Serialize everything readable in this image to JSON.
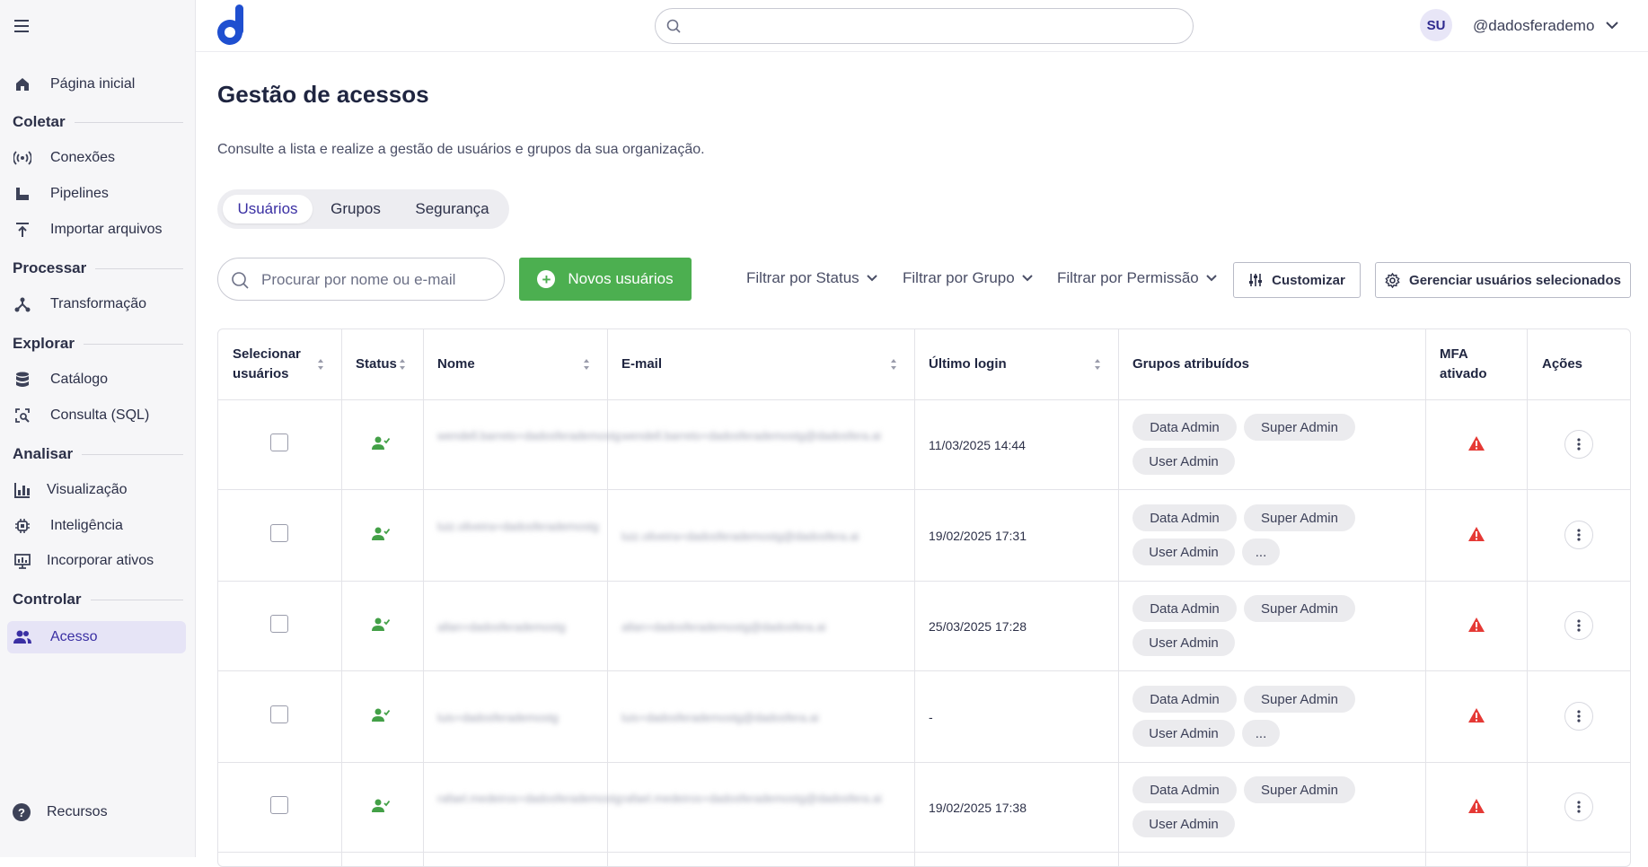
{
  "sidebar": {
    "items": [
      {
        "id": "home",
        "label": "Página inicial",
        "icon": "home-icon"
      },
      {
        "id": "conexoes",
        "label": "Conexões",
        "icon": "broadcast-icon"
      },
      {
        "id": "pipelines",
        "label": "Pipelines",
        "icon": "pipeline-icon"
      },
      {
        "id": "importar",
        "label": "Importar arquivos",
        "icon": "upload-icon"
      },
      {
        "id": "transformacao",
        "label": "Transformação",
        "icon": "transform-icon"
      },
      {
        "id": "catalogo",
        "label": "Catálogo",
        "icon": "database-icon"
      },
      {
        "id": "consulta",
        "label": "Consulta (SQL)",
        "icon": "query-icon"
      },
      {
        "id": "visualizacao",
        "label": "Visualização",
        "icon": "bar-chart-icon"
      },
      {
        "id": "inteligencia",
        "label": "Inteligência",
        "icon": "chip-icon"
      },
      {
        "id": "incorporar",
        "label": "Incorporar ativos",
        "icon": "embed-icon"
      },
      {
        "id": "acesso",
        "label": "Acesso",
        "icon": "users-icon",
        "active": true
      }
    ],
    "sections": [
      "Coletar",
      "Processar",
      "Explorar",
      "Analisar",
      "Controlar"
    ],
    "footer_label": "Recursos"
  },
  "header": {
    "avatar_initials": "SU",
    "username": "@dadosferademo"
  },
  "page": {
    "title": "Gestão de acessos",
    "subtitle": "Consulte a lista e realize a gestão de usuários e grupos da sua organização."
  },
  "tabs": [
    "Usuários",
    "Grupos",
    "Segurança"
  ],
  "toolbar": {
    "search_placeholder": "Procurar por nome ou e-mail",
    "new_users_label": "Novos usuários",
    "filter_status": "Filtrar por Status",
    "filter_group": "Filtrar por Grupo",
    "filter_permission": "Filtrar por Permissão",
    "customize_label": "Customizar",
    "manage_label": "Gerenciar usuários selecionados"
  },
  "table": {
    "headers": {
      "select_line1": "Selecionar",
      "select_line2": "usuários",
      "status": "Status",
      "name": "Nome",
      "email": "E-mail",
      "last_login": "Último login",
      "groups": "Grupos atribuídos",
      "mfa_line1": "MFA",
      "mfa_line2": "ativado",
      "actions": "Ações"
    },
    "rows": [
      {
        "name": "wendell.barreto+dadosferademostg",
        "email": "wendell.barreto+dadosferademostg@dadosfera.ai",
        "last_login": "11/03/2025 14:44",
        "groups": [
          "Data Admin",
          "Super Admin",
          "User Admin"
        ]
      },
      {
        "name": "luiz.oliveira+dadosferademostg",
        "email": "luiz.oliveira+dadosferademostg@dadosfera.ai",
        "last_login": "19/02/2025 17:31",
        "groups": [
          "Data Admin",
          "Super Admin",
          "User Admin",
          "..."
        ]
      },
      {
        "name": "allan+dadosferademostg",
        "email": "allan+dadosferademostg@dadosfera.ai",
        "last_login": "25/03/2025 17:28",
        "groups": [
          "Data Admin",
          "Super Admin",
          "User Admin"
        ]
      },
      {
        "name": "luis+dadosferademostg",
        "email": "luis+dadosferademostg@dadosfera.ai",
        "last_login": "-",
        "groups": [
          "Data Admin",
          "Super Admin",
          "User Admin",
          "..."
        ]
      },
      {
        "name": "rafael.medeiros+dadosferademostg",
        "email": "rafael.medeiros+dadosferademostg@dadosfera.ai",
        "last_login": "19/02/2025 17:38",
        "groups": [
          "Data Admin",
          "Super Admin",
          "User Admin"
        ]
      }
    ]
  },
  "colors": {
    "accent": "#3a2fa3",
    "primary_button": "#4caf50",
    "warning": "#e53935",
    "status_active": "#43a047"
  }
}
